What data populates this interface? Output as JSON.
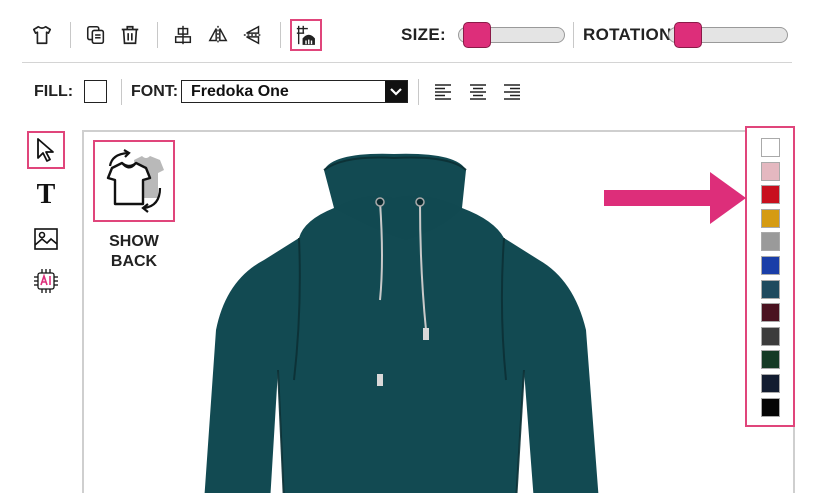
{
  "toolbar": {
    "tools": [
      {
        "name": "tshirt-icon"
      },
      {
        "name": "duplicate-icon"
      },
      {
        "name": "trash-icon"
      },
      {
        "name": "align-center-vertical-icon"
      },
      {
        "name": "flip-horizontal-icon"
      },
      {
        "name": "flip-vertical-icon"
      },
      {
        "name": "center-grid-icon",
        "active": true
      }
    ],
    "size_label": "SIZE:",
    "size_value": 0.05,
    "rotation_label": "ROTATION:",
    "rotation_value": 0.05,
    "accent_color": "#dd2e7a"
  },
  "format_bar": {
    "fill_label": "FILL:",
    "fill_color": "#ffffff",
    "font_label": "FONT:",
    "font_value": "Fredoka One",
    "align_options": [
      "align-left-icon",
      "align-center-icon",
      "align-right-icon"
    ]
  },
  "left_tools": [
    {
      "name": "select-cursor-icon",
      "active": true
    },
    {
      "name": "text-tool-icon",
      "glyph": "T"
    },
    {
      "name": "image-tool-icon"
    },
    {
      "name": "ai-tool-icon"
    }
  ],
  "canvas": {
    "show_back_label_line1": "SHOW",
    "show_back_label_line2": "BACK",
    "garment_color": "#124a52"
  },
  "palette": {
    "colors": [
      "#ffffff",
      "#e4b8c0",
      "#c8101e",
      "#d59b12",
      "#9a9a9a",
      "#1a3ea8",
      "#1f4a5e",
      "#4a1220",
      "#3c3c3c",
      "#153a25",
      "#121c30",
      "#050505"
    ]
  }
}
